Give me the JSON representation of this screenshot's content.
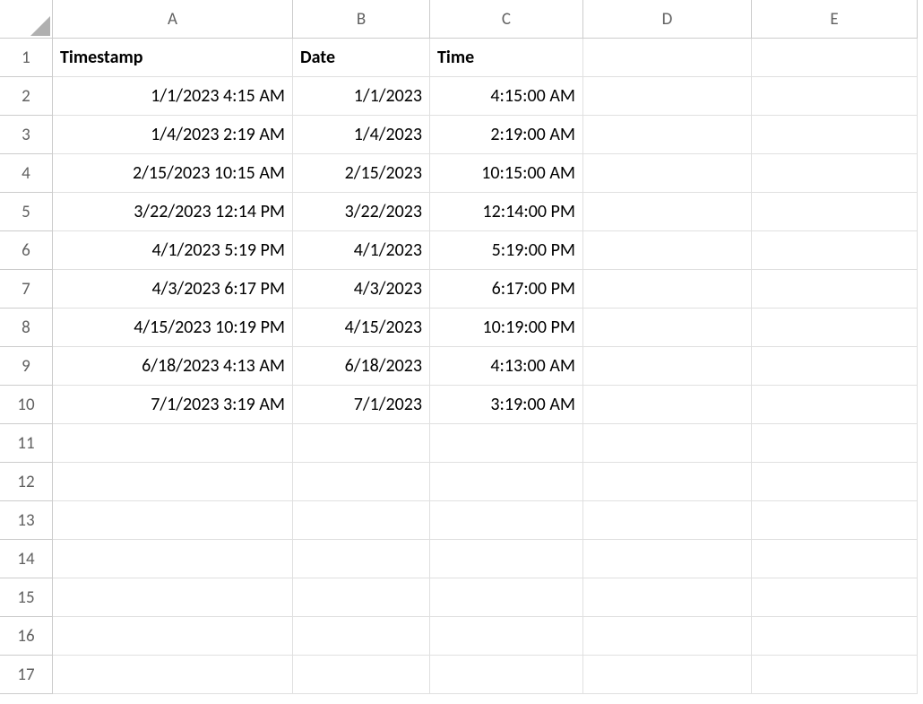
{
  "columns": [
    "A",
    "B",
    "C",
    "D",
    "E"
  ],
  "rowCount": 17,
  "headers": {
    "A": "Timestamp",
    "B": "Date",
    "C": "Time"
  },
  "rows": [
    {
      "timestamp": "1/1/2023 4:15 AM",
      "date": "1/1/2023",
      "time": "4:15:00 AM"
    },
    {
      "timestamp": "1/4/2023 2:19 AM",
      "date": "1/4/2023",
      "time": "2:19:00 AM"
    },
    {
      "timestamp": "2/15/2023 10:15 AM",
      "date": "2/15/2023",
      "time": "10:15:00 AM"
    },
    {
      "timestamp": "3/22/2023 12:14 PM",
      "date": "3/22/2023",
      "time": "12:14:00 PM"
    },
    {
      "timestamp": "4/1/2023 5:19 PM",
      "date": "4/1/2023",
      "time": "5:19:00 PM"
    },
    {
      "timestamp": "4/3/2023 6:17 PM",
      "date": "4/3/2023",
      "time": "6:17:00 PM"
    },
    {
      "timestamp": "4/15/2023 10:19 PM",
      "date": "4/15/2023",
      "time": "10:19:00 PM"
    },
    {
      "timestamp": "6/18/2023 4:13 AM",
      "date": "6/18/2023",
      "time": "4:13:00 AM"
    },
    {
      "timestamp": "7/1/2023 3:19 AM",
      "date": "7/1/2023",
      "time": "3:19:00 AM"
    }
  ]
}
